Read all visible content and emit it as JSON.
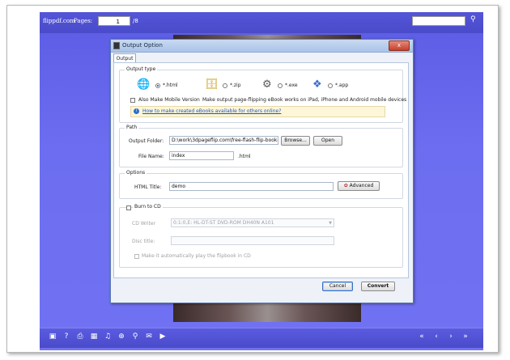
{
  "viewer": {
    "brand": "flippdf.com",
    "pages_label": "Pages:",
    "page_value": "1",
    "page_sep": "/8",
    "search_icon": "magnifier-icon",
    "bottom_icons": [
      "fullscreen-icon",
      "help-icon",
      "print-icon",
      "thumbnails-icon",
      "sound-icon",
      "zoom-in-icon",
      "search-icon",
      "email-icon",
      "play-icon"
    ],
    "nav_icons": [
      "first-page-icon",
      "prev-page-icon",
      "next-page-icon",
      "last-page-icon"
    ],
    "colors": {
      "viewer_bg": "#6c6df0",
      "toolbar": "#4a4bc9"
    }
  },
  "dialog": {
    "title": "Output Option",
    "close_label": "x",
    "tab": "Output",
    "output_type": {
      "title": "Output type",
      "options": [
        {
          "label": "*.html",
          "selected": true
        },
        {
          "label": "*.zip",
          "selected": false
        },
        {
          "label": "*.exe",
          "selected": false
        },
        {
          "label": "*.app",
          "selected": false
        }
      ],
      "mobile_label": "Also Make Mobile Version",
      "mobile_desc": "Make output page-flipping eBook works on iPad, iPhone and Android mobile devices",
      "help_link": "How to make created eBooks available for others online?"
    },
    "path": {
      "title": "Path",
      "folder_label": "Output Folder:",
      "folder_value": "D:\\work\\3dpageflip.com\\free-flash-flip-book-maker",
      "browse": "Browse...",
      "open": "Open",
      "filename_label": "File Name:",
      "filename_value": "index",
      "ext": ".html"
    },
    "options": {
      "title": "Options",
      "html_title_label": "HTML Title:",
      "html_title_value": "demo",
      "advanced": "Advanced"
    },
    "burn": {
      "title": "Burn to CD",
      "writer_label": "CD Writer",
      "writer_value": "0:1:0,E: HL-DT-ST DVD-ROM DH40N   A101",
      "disc_label": "Disc title:",
      "disc_value": "",
      "autoplay_label": "Make it automatically play the flipbook in CD"
    },
    "cancel": "Cancel",
    "convert": "Convert"
  }
}
